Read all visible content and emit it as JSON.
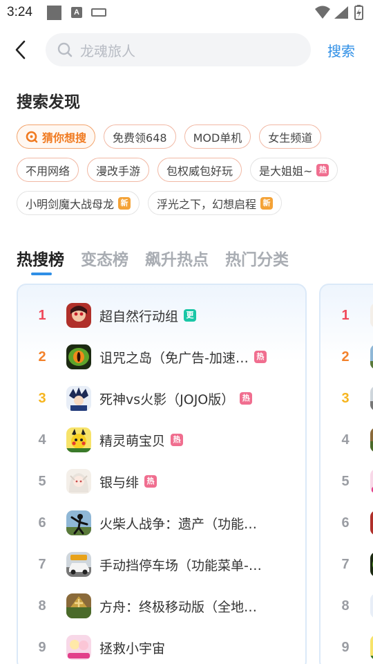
{
  "status_bar": {
    "time": "3:24",
    "a_glyph": "A"
  },
  "header": {
    "back_icon": "chevron-left-icon",
    "search_placeholder": "龙魂旅人",
    "search_button": "搜索"
  },
  "discover": {
    "title": "搜索发现",
    "chips": [
      [
        {
          "label": "猜你想搜",
          "style": "primary"
        },
        {
          "label": "免费领648",
          "style": "normal"
        },
        {
          "label": "MOD单机",
          "style": "normal"
        },
        {
          "label": "女生频道",
          "style": "normal"
        }
      ],
      [
        {
          "label": "不用网络",
          "style": "normal"
        },
        {
          "label": "漫改手游",
          "style": "normal"
        },
        {
          "label": "包权威包好玩",
          "style": "normal"
        },
        {
          "label": "是大姐姐~",
          "style": "gray",
          "badge": "热"
        }
      ],
      [
        {
          "label": "小明剑魔大战母龙",
          "style": "gray",
          "badge": "新"
        },
        {
          "label": "浮光之下，幻想启程",
          "style": "gray",
          "badge": "新"
        }
      ]
    ]
  },
  "tabs": [
    "热搜榜",
    "变态榜",
    "飙升热点",
    "热门分类"
  ],
  "ranking": [
    {
      "rank": "1",
      "name": "超自然行动组",
      "badge": "更",
      "badge_color": "#1ac6a6"
    },
    {
      "rank": "2",
      "name": "诅咒之岛（免广告-加速…",
      "badge": "热",
      "badge_color": "#f06e8f"
    },
    {
      "rank": "3",
      "name": "死神vs火影（JOJO版）",
      "badge": "热",
      "badge_color": "#f06e8f"
    },
    {
      "rank": "4",
      "name": "精灵萌宝贝",
      "badge": "热",
      "badge_color": "#f06e8f"
    },
    {
      "rank": "5",
      "name": "银与绯",
      "badge": "热",
      "badge_color": "#f06e8f"
    },
    {
      "rank": "6",
      "name": "火柴人战争：遗产（功能…",
      "badge": "",
      "badge_color": ""
    },
    {
      "rank": "7",
      "name": "手动挡停车场（功能菜单-…",
      "badge": "",
      "badge_color": ""
    },
    {
      "rank": "8",
      "name": "方舟：终极移动版（全地…",
      "badge": "",
      "badge_color": ""
    },
    {
      "rank": "9",
      "name": "拯救小宇宙",
      "badge": "",
      "badge_color": ""
    }
  ],
  "ranking_second": [
    "1",
    "2",
    "3",
    "4",
    "5",
    "6",
    "7",
    "8",
    "9"
  ]
}
